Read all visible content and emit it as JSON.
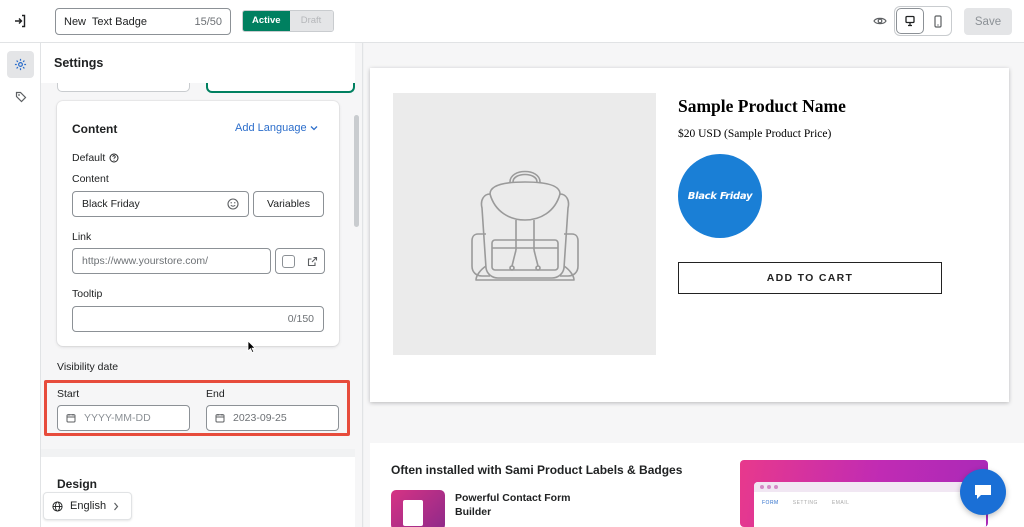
{
  "topbar": {
    "badge_title": "New  Text Badge",
    "title_count": "15/50",
    "status_active": "Active",
    "status_draft": "Draft",
    "save_label": "Save"
  },
  "rail": {
    "items": [
      {
        "icon": "gear-icon",
        "selected": true
      },
      {
        "icon": "tag-icon",
        "selected": false
      }
    ]
  },
  "panel": {
    "title": "Settings",
    "content": {
      "title": "Content",
      "add_language": "Add Language",
      "default_label": "Default",
      "content_label": "Content",
      "content_value": "Black Friday",
      "variables_label": "Variables",
      "link_label": "Link",
      "link_placeholder": "https://www.yourstore.com/",
      "tooltip_label": "Tooltip",
      "tooltip_count": "0/150"
    },
    "visibility": {
      "title": "Visibility date",
      "start_label": "Start",
      "start_placeholder": "YYYY-MM-DD",
      "end_label": "End",
      "end_value": "2023-09-25"
    },
    "design_title": "Design",
    "language_label": "English"
  },
  "preview": {
    "product_name": "Sample Product Name",
    "product_price": "$20 USD (Sample Product Price)",
    "badge_text": "Black Friday",
    "badge_color": "#1a7fd6",
    "add_to_cart": "ADD TO CART",
    "promo_title": "Often installed with Sami Product Labels & Badges",
    "promo_app_name": "Powerful Contact Form Builder",
    "promo_tabs": [
      "FORM",
      "SETTING",
      "EMAIL"
    ]
  },
  "colors": {
    "accent": "#008060",
    "link": "#2c6ecb",
    "highlight": "#e74c3c"
  }
}
